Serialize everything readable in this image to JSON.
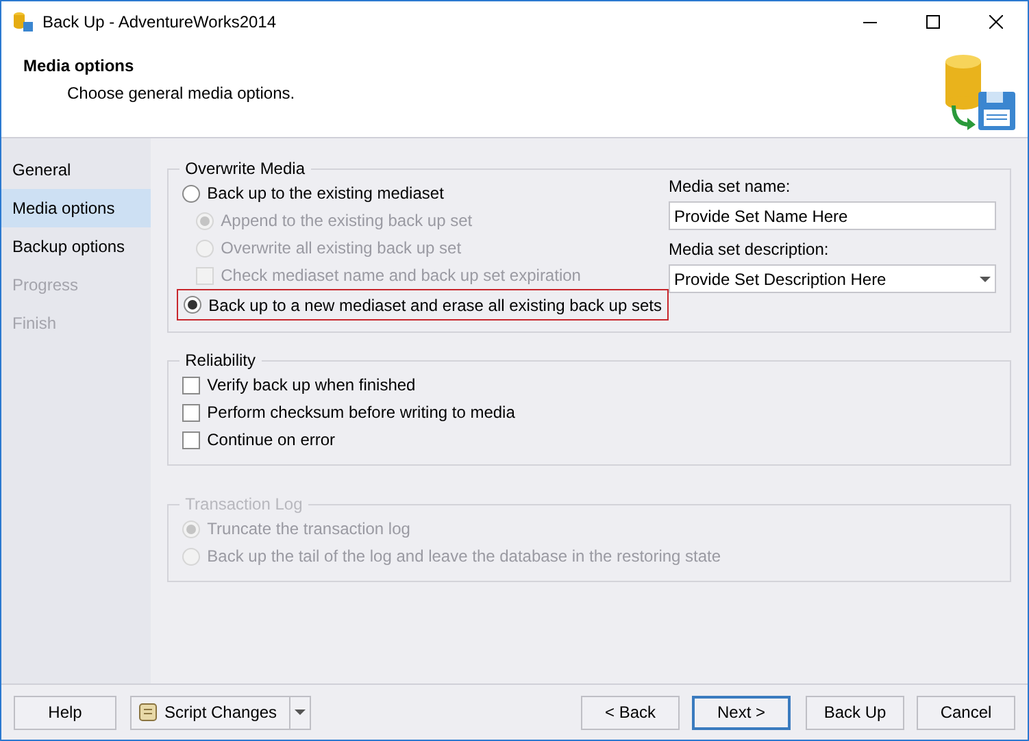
{
  "window": {
    "title": "Back Up - AdventureWorks2014"
  },
  "header": {
    "title": "Media options",
    "subtitle": "Choose general media options."
  },
  "sidebar": {
    "items": [
      {
        "label": "General",
        "selected": false,
        "disabled": false
      },
      {
        "label": "Media options",
        "selected": true,
        "disabled": false
      },
      {
        "label": "Backup options",
        "selected": false,
        "disabled": false
      },
      {
        "label": "Progress",
        "selected": false,
        "disabled": true
      },
      {
        "label": "Finish",
        "selected": false,
        "disabled": true
      }
    ]
  },
  "overwrite_media": {
    "title": "Overwrite Media",
    "disabled": false,
    "options": [
      {
        "kind": "radio",
        "label": "Back up to the existing mediaset",
        "selected": false,
        "disabled": false,
        "highlighted": false,
        "children": [
          {
            "kind": "radio",
            "label": "Append to the existing back up set",
            "selected": true,
            "disabled": true,
            "highlighted": false
          },
          {
            "kind": "radio",
            "label": "Overwrite all existing back up set",
            "selected": false,
            "disabled": true,
            "highlighted": false
          },
          {
            "kind": "checkbox",
            "label": "Check mediaset name and back up set expiration",
            "checked": false,
            "disabled": true,
            "highlighted": false
          }
        ]
      },
      {
        "kind": "radio",
        "label": "Back up to a new mediaset and erase all existing back up sets",
        "selected": true,
        "disabled": false,
        "highlighted": true
      }
    ],
    "media_set_name": {
      "label": "Media set name:",
      "value": "Provide Set Name Here"
    },
    "media_set_description": {
      "label": "Media set description:",
      "value": "Provide Set Description Here"
    }
  },
  "reliability": {
    "title": "Reliability",
    "disabled": false,
    "options": [
      {
        "kind": "checkbox",
        "label": "Verify back up when finished",
        "checked": false,
        "disabled": false,
        "highlighted": false
      },
      {
        "kind": "checkbox",
        "label": "Perform checksum before writing to media",
        "checked": false,
        "disabled": false,
        "highlighted": false
      },
      {
        "kind": "checkbox",
        "label": "Continue on error",
        "checked": false,
        "disabled": false,
        "highlighted": false
      }
    ]
  },
  "transaction_log": {
    "title": "Transaction Log",
    "disabled": true,
    "options": [
      {
        "kind": "radio",
        "label": "Truncate the transaction log",
        "selected": true,
        "disabled": true,
        "highlighted": false
      },
      {
        "kind": "radio",
        "label": "Back up the tail of the log and leave the database in the restoring state",
        "selected": false,
        "disabled": true,
        "highlighted": false
      }
    ]
  },
  "footer": {
    "left_buttons": [
      {
        "kind": "plain",
        "label": "Help",
        "default": false
      },
      {
        "kind": "script",
        "label": "Script Changes",
        "default": false
      }
    ],
    "right_buttons": [
      {
        "label": "< Back",
        "default": false
      },
      {
        "label": "Next >",
        "default": true
      },
      {
        "label": "Back Up",
        "default": false
      },
      {
        "label": "Cancel",
        "default": false
      }
    ]
  }
}
